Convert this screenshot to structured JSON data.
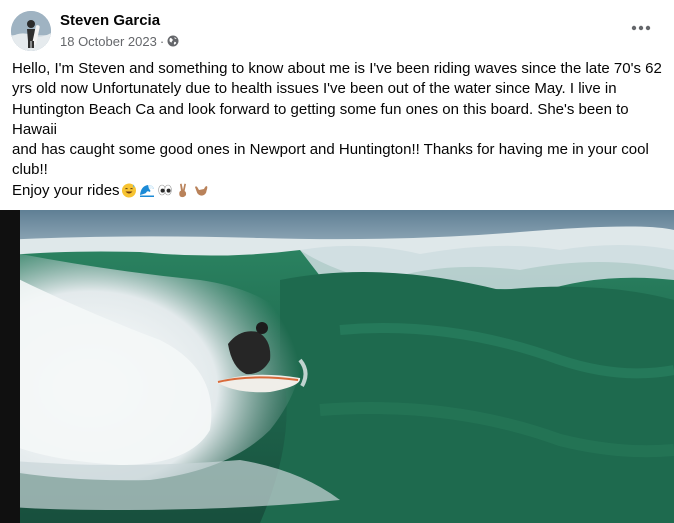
{
  "post": {
    "author": "Steven Garcia",
    "date": "18 October 2023",
    "separator": "·",
    "privacy_icon": "globe-icon",
    "more_icon": "more-options-icon",
    "text_lines": [
      "Hello, I'm Steven and something to know about me is I've been riding waves since the late 70's 62 yrs old now Unfortunately due to health issues I've been out of the water since May. I live in Huntington Beach Ca and look forward to getting some fun ones on this board. She's been to Hawaii",
      "and has caught some good ones in Newport and Huntington!! Thanks for having me in your cool club!!",
      "Enjoy your rides"
    ],
    "emojis": [
      "grinning-sweat-emoji",
      "wave-emoji",
      "eyes-emoji",
      "victory-hand-emoji",
      "call-me-hand-emoji"
    ],
    "photo": {
      "subject": "surf-photo",
      "colors": {
        "wave_green": "#1f6a4f",
        "sky": "#6f8fa3",
        "foam": "#e9eef0"
      }
    }
  }
}
